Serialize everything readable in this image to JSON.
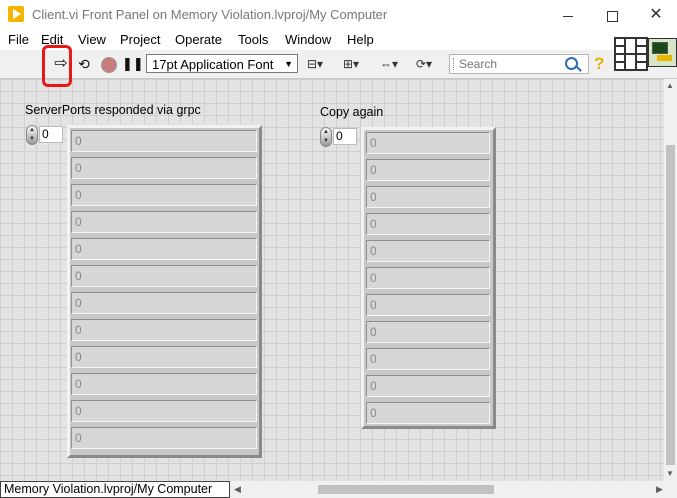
{
  "window": {
    "title": "Client.vi Front Panel on Memory Violation.lvproj/My Computer",
    "close_glyph": "✕"
  },
  "menu": [
    "File",
    "Edit",
    "View",
    "Project",
    "Operate",
    "Tools",
    "Window",
    "Help"
  ],
  "toolbar": {
    "run_glyph": "⇨",
    "run_continuous_glyph": "⟲",
    "pause_glyph": "❚❚",
    "font_select": "17pt Application Font",
    "font_select_arrow": "▼",
    "align_glyph": "⊟▾",
    "distribute_glyph": "⊞▾",
    "resize_glyph": "⇔▾",
    "reorder_glyph": "⟳▾",
    "search_placeholder": "Search",
    "help_glyph": "?"
  },
  "arrays": [
    {
      "label": "ServerPorts responded via grpc",
      "index": "0",
      "cells": [
        "0",
        "0",
        "0",
        "0",
        "0",
        "0",
        "0",
        "0",
        "0",
        "0",
        "0",
        "0"
      ]
    },
    {
      "label": "Copy again",
      "index": "0",
      "cells": [
        "0",
        "0",
        "0",
        "0",
        "0",
        "0",
        "0",
        "0",
        "0",
        "0",
        "0"
      ]
    }
  ],
  "status_bar": "Memory Violation.lvproj/My Computer",
  "scroll": {
    "up": "▲",
    "down": "▼",
    "left": "◀",
    "right": "▶"
  },
  "colors": {
    "highlight": "#e81818",
    "panel_bg": "#e3e3e3",
    "app_icon": "#f5b400"
  }
}
